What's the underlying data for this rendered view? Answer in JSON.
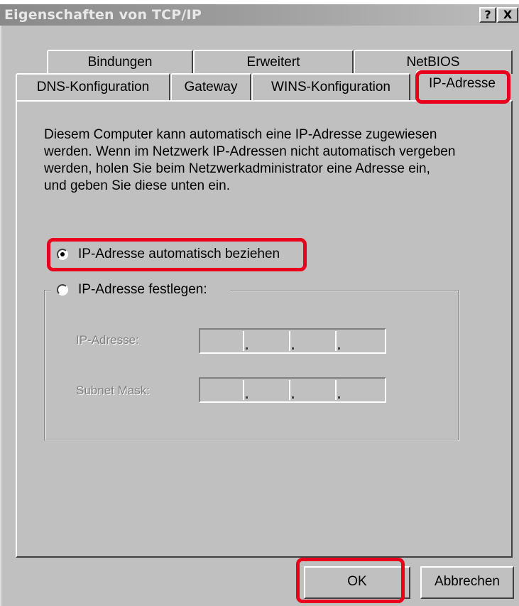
{
  "window": {
    "title": "Eigenschaften von TCP/IP",
    "help_label": "?",
    "close_label": "X"
  },
  "tabs": {
    "row1": [
      {
        "label": "Bindungen"
      },
      {
        "label": "Erweitert"
      },
      {
        "label": "NetBIOS"
      }
    ],
    "row2": [
      {
        "label": "DNS-Konfiguration"
      },
      {
        "label": "Gateway"
      },
      {
        "label": "WINS-Konfiguration"
      },
      {
        "label": "IP-Adresse",
        "active": true
      }
    ]
  },
  "panel": {
    "description": "Diesem Computer kann automatisch eine IP-Adresse zugewiesen werden. Wenn im Netzwerk IP-Adressen nicht automatisch vergeben werden, holen Sie beim Netzwerkadministrator eine Adresse ein, und geben Sie diese unten ein.",
    "option_auto": {
      "label": "IP-Adresse automatisch beziehen",
      "selected": true
    },
    "option_manual": {
      "label": "IP-Adresse festlegen:",
      "selected": false
    },
    "ip_address": {
      "label": "IP-Adresse:",
      "value": [
        "",
        "",
        "",
        ""
      ],
      "enabled": false
    },
    "subnet_mask": {
      "label": "Subnet Mask:",
      "value": [
        "",
        "",
        "",
        ""
      ],
      "enabled": false
    }
  },
  "buttons": {
    "ok": "OK",
    "cancel": "Abbrechen"
  },
  "colors": {
    "dialog_face": "#c0c0c0",
    "highlight": "#e8001c"
  }
}
